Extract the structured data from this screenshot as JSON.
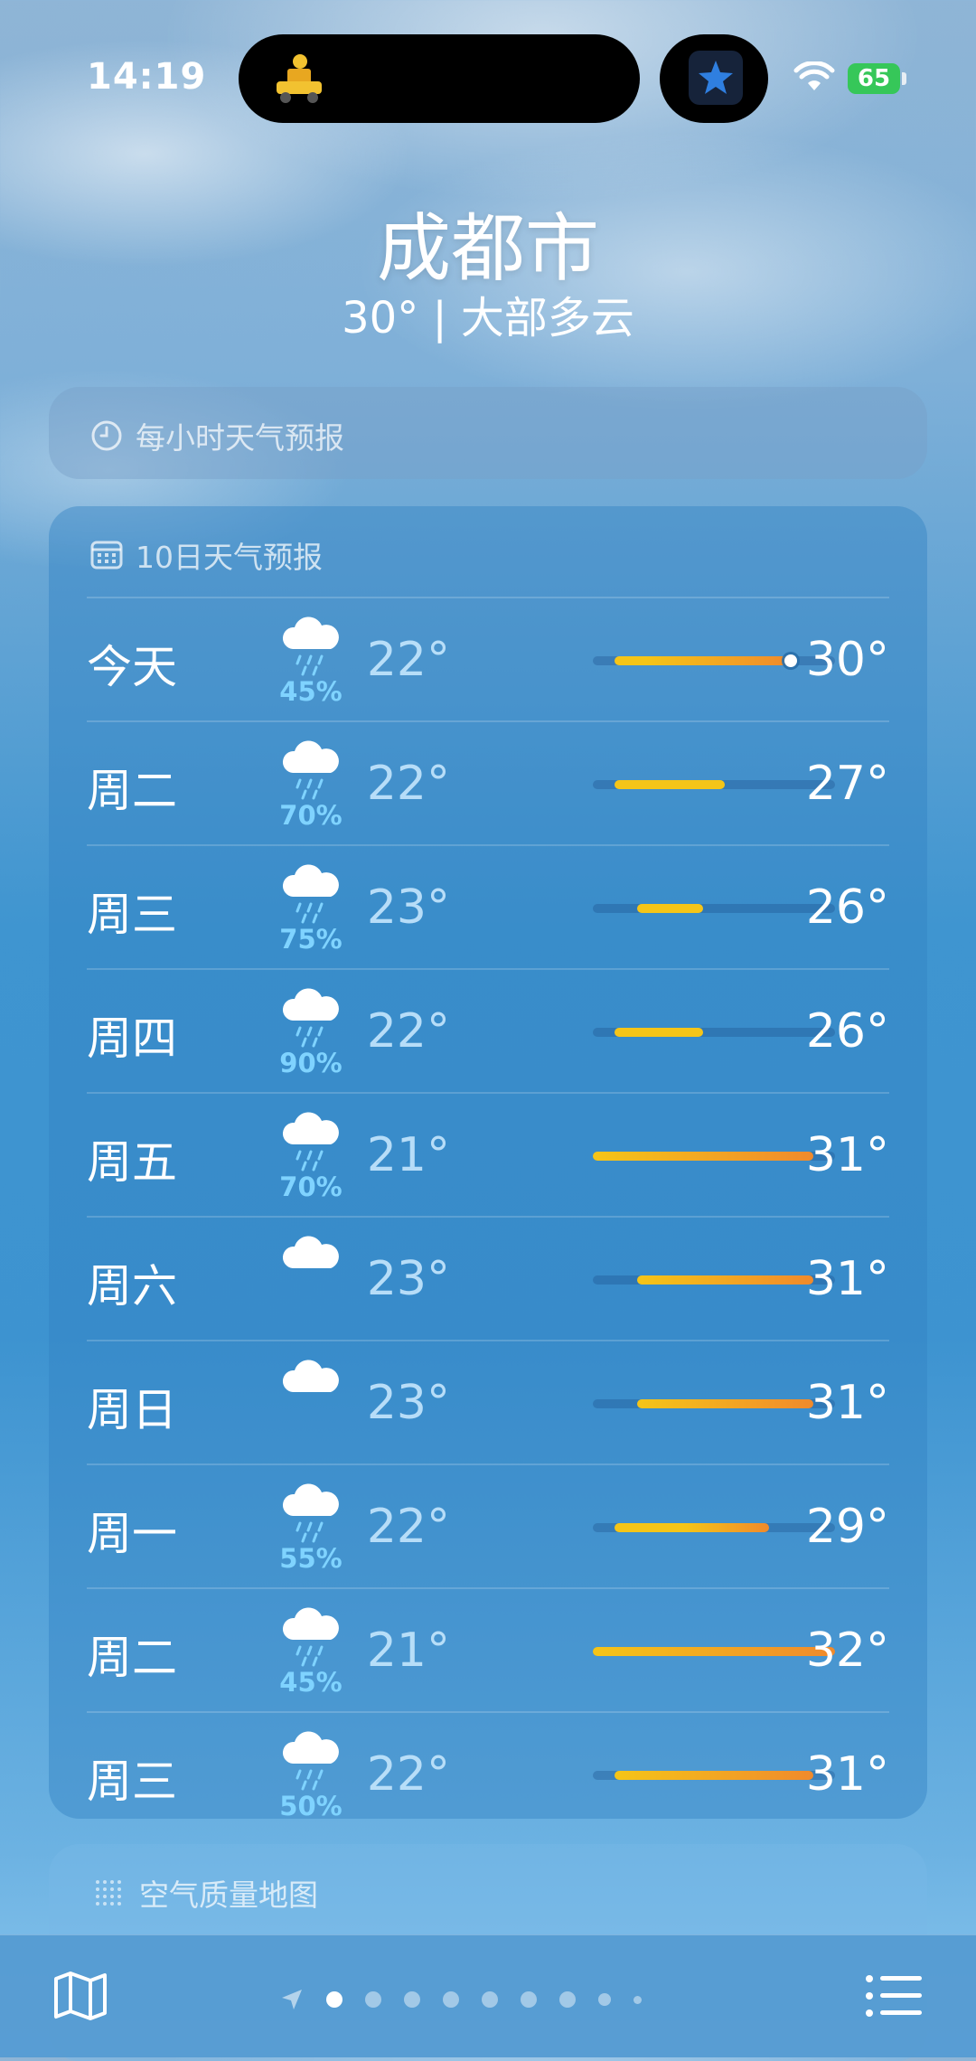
{
  "status_bar": {
    "time": "14:19",
    "battery": "65",
    "icons": [
      "delivery-activity-icon",
      "star-app-icon",
      "wifi-icon",
      "battery-charging-icon"
    ]
  },
  "location": {
    "city": "成都市",
    "summary": "30° | 大部多云"
  },
  "hourly_card": {
    "title": "每小时天气预报",
    "icon": "clock-icon"
  },
  "daily_card": {
    "title": "10日天气预报",
    "icon": "calendar-icon",
    "range_min": 21,
    "range_max": 32,
    "current_temp": 30,
    "days": [
      {
        "day": "今天",
        "icon": "rain-cloud-icon",
        "precip": "45%",
        "low": "22°",
        "high": "30°",
        "low_v": 22,
        "high_v": 30
      },
      {
        "day": "周二",
        "icon": "rain-cloud-icon",
        "precip": "70%",
        "low": "22°",
        "high": "27°",
        "low_v": 22,
        "high_v": 27
      },
      {
        "day": "周三",
        "icon": "rain-cloud-icon",
        "precip": "75%",
        "low": "23°",
        "high": "26°",
        "low_v": 23,
        "high_v": 26
      },
      {
        "day": "周四",
        "icon": "rain-cloud-icon",
        "precip": "90%",
        "low": "22°",
        "high": "26°",
        "low_v": 22,
        "high_v": 26
      },
      {
        "day": "周五",
        "icon": "rain-cloud-icon",
        "precip": "70%",
        "low": "21°",
        "high": "31°",
        "low_v": 21,
        "high_v": 31
      },
      {
        "day": "周六",
        "icon": "cloud-icon",
        "precip": "",
        "low": "23°",
        "high": "31°",
        "low_v": 23,
        "high_v": 31
      },
      {
        "day": "周日",
        "icon": "cloud-icon",
        "precip": "",
        "low": "23°",
        "high": "31°",
        "low_v": 23,
        "high_v": 31
      },
      {
        "day": "周一",
        "icon": "rain-cloud-icon",
        "precip": "55%",
        "low": "22°",
        "high": "29°",
        "low_v": 22,
        "high_v": 29
      },
      {
        "day": "周二",
        "icon": "rain-cloud-icon",
        "precip": "45%",
        "low": "21°",
        "high": "32°",
        "low_v": 21,
        "high_v": 32
      },
      {
        "day": "周三",
        "icon": "rain-cloud-icon",
        "precip": "50%",
        "low": "22°",
        "high": "31°",
        "low_v": 22,
        "high_v": 31
      }
    ]
  },
  "aqi_card": {
    "title": "空气质量地图",
    "icon": "aqi-dots-icon"
  },
  "tab_bar": {
    "map_icon": "map-icon",
    "list_icon": "list-icon",
    "page_count": 9,
    "active_page": 1
  },
  "colors": {
    "bar_cool": "#f5c518",
    "bar_warm": "#f08a2c",
    "precip": "#7fd3ff"
  }
}
